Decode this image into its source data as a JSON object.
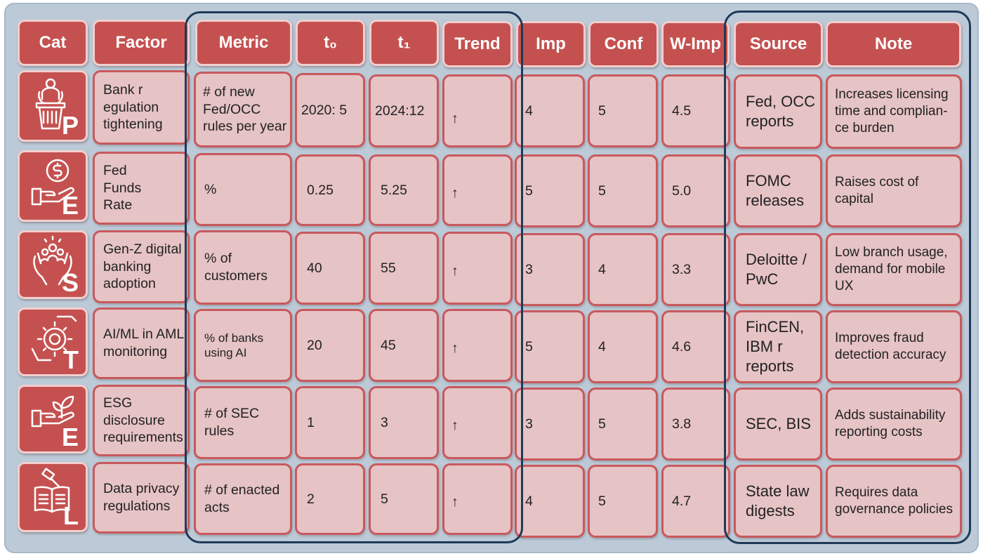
{
  "headers": {
    "cat": "Cat",
    "factor": "Factor",
    "metric": "Metric",
    "t0": "t₀",
    "t1": "t₁",
    "trend": "Trend",
    "imp": "Imp",
    "conf": "Conf",
    "wimp": "W-Imp",
    "source": "Source",
    "note": "Note"
  },
  "icons": [
    "podium-speaker-icon",
    "hand-dollar-coin-icon",
    "hands-people-icon",
    "hands-gear-icon",
    "hand-plant-icon",
    "gavel-book-icon"
  ],
  "rows": [
    {
      "cat_letter": "P",
      "factor": [
        "Bank r",
        "egulation",
        "tightening"
      ],
      "metric": [
        "# of new",
        "Fed/OCC",
        "rules per year"
      ],
      "t0": "2020: 5",
      "t1": "2024:12",
      "trend": "↑",
      "imp": "4",
      "conf": "5",
      "wimp": "4.5",
      "source": [
        "Fed, OCC",
        "reports"
      ],
      "note": [
        "Increases licensing",
        "time and complian-",
        "ce burden"
      ]
    },
    {
      "cat_letter": "E",
      "factor": [
        "Fed",
        "Funds",
        "Rate"
      ],
      "metric": [
        "%"
      ],
      "t0": "0.25",
      "t1": "5.25",
      "trend": "↑",
      "imp": "5",
      "conf": "5",
      "wimp": "5.0",
      "source": [
        "FOMC",
        "releases"
      ],
      "note": [
        "Raises cost of",
        "capital"
      ]
    },
    {
      "cat_letter": "S",
      "factor": [
        "Gen-Z digital",
        "banking",
        "adoption"
      ],
      "metric": [
        "% of",
        "customers"
      ],
      "t0": "40",
      "t1": "55",
      "trend": "↑",
      "imp": "3",
      "conf": "4",
      "wimp": "3.3",
      "source": [
        "Deloitte /",
        "PwC"
      ],
      "note": [
        "Low branch usage,",
        "demand for mobile",
        "UX"
      ]
    },
    {
      "cat_letter": "T",
      "factor": [
        "AI/ML in AML",
        "monitoring"
      ],
      "metric": [
        "% of banks",
        "using AI"
      ],
      "t0": "20",
      "t1": "45",
      "trend": "↑",
      "imp": "5",
      "conf": "4",
      "wimp": "4.6",
      "source": [
        "FinCEN,",
        "IBM r",
        "reports"
      ],
      "note": [
        "Improves fraud",
        "detection accuracy"
      ]
    },
    {
      "cat_letter": "E",
      "factor": [
        "ESG",
        "disclosure",
        "requirements"
      ],
      "metric": [
        "# of SEC",
        "rules"
      ],
      "t0": "1",
      "t1": "3",
      "trend": "↑",
      "imp": "3",
      "conf": "5",
      "wimp": "3.8",
      "source": [
        "SEC, BIS"
      ],
      "note": [
        "Adds sustainability",
        "reporting costs"
      ]
    },
    {
      "cat_letter": "L",
      "factor": [
        "Data privacy",
        "regulations"
      ],
      "metric": [
        "# of enacted",
        "acts"
      ],
      "t0": "2",
      "t1": "5",
      "trend": "↑",
      "imp": "4",
      "conf": "5",
      "wimp": "4.7",
      "source": [
        "State law",
        "digests"
      ],
      "note": [
        "Requires data",
        "governance policies"
      ]
    }
  ]
}
